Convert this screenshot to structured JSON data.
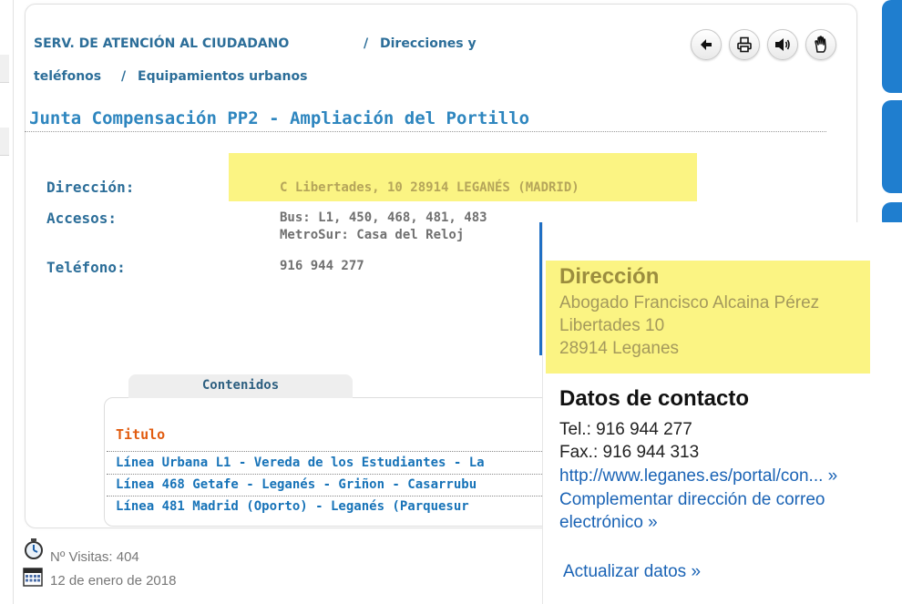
{
  "breadcrumb": {
    "part1": "SERV. DE ATENCIÓN AL CIUDADANO",
    "sep1": "/",
    "part2": "Direcciones y",
    "part3": "teléfonos",
    "sep2": "/",
    "part4": "Equipamientos urbanos"
  },
  "toolbar": {
    "icons": [
      "back-arrow-icon",
      "print-icon",
      "speaker-icon",
      "hand-icon"
    ]
  },
  "page_title": "Junta Compensación PP2 - Ampliación del Portillo",
  "details": {
    "direccion_label": "Dirección:",
    "direccion_value": "C Libertades, 10  28914  LEGANÉS (MADRID)",
    "accesos_label": "Accesos:",
    "accesos_line1": "Bus: L1, 450, 468, 481, 483",
    "accesos_line2": "MetroSur: Casa del Reloj",
    "telefono_label": "Teléfono:",
    "telefono_value": "916 944 277"
  },
  "contents": {
    "tab_label": "Contenidos",
    "column_header": "Titulo",
    "rows": [
      "Línea Urbana L1 - Vereda de los Estudiantes - La",
      "Línea 468 Getafe - Leganés - Griñon - Casarrubu",
      "Línea 481 Madrid (Oporto) - Leganés (Parquesur"
    ]
  },
  "footer": {
    "visits": "Nº Visitas: 404",
    "date": "12 de enero de 2018"
  },
  "overlay": {
    "address_heading": "Dirección",
    "address_line1": "Abogado Francisco Alcaina Pérez",
    "address_line2": "Libertades 10",
    "address_line3": "28914 Leganes",
    "contact_heading": "Datos de contacto",
    "tel": "Tel.: 916 944 277",
    "fax": "Fax.: 916 944 313",
    "website": "http://www.leganes.es/portal/con... »",
    "complement_line1": "Complementar dirección de correo",
    "complement_line2": "electrónico »",
    "update": "Actualizar datos »"
  },
  "colors": {
    "accent_blue": "#2c6e99",
    "title_blue": "#2e86bf",
    "link_blue": "#1773b8",
    "highlight_yellow": "#fbf483",
    "header_orange": "#e15b0f"
  }
}
